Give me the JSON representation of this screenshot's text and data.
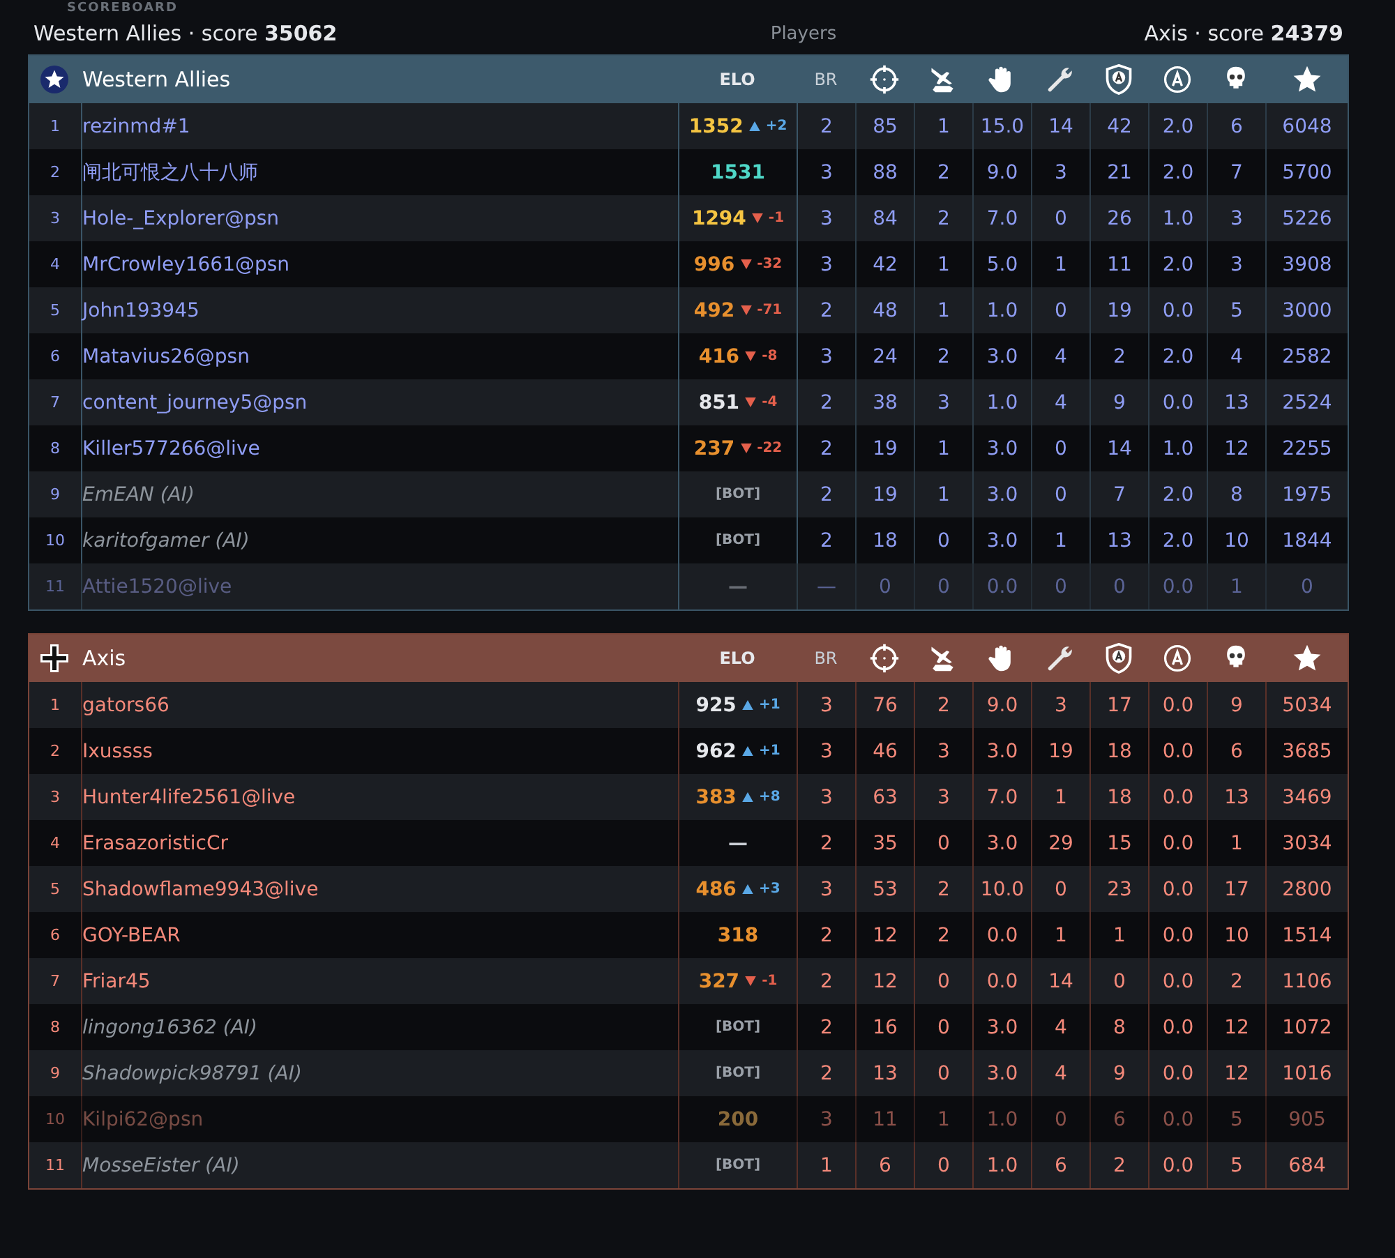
{
  "heading": "SCOREBOARD",
  "summary": {
    "left": "Western Allies · score **35062**",
    "center": "Players",
    "right": "Axis · score **24379**"
  },
  "teams": [
    {
      "name": "Western Allies",
      "kind": "allies",
      "columns": [
        "ELO",
        "BR"
      ],
      "rows": [
        {
          "rank": "1",
          "name": "rezinmd#1",
          "ai": false,
          "inactive": false,
          "elo": "1352",
          "color": "#f5c542",
          "kind": "gain",
          "delta": "+2",
          "stats": [
            "2",
            "85",
            "1",
            "15.0",
            "14",
            "42",
            "2.0",
            "6",
            "6048"
          ]
        },
        {
          "rank": "2",
          "name": "闸北可恨之八十八师",
          "ai": false,
          "inactive": false,
          "elo": "1531",
          "color": "#4fd8c8",
          "kind": "steady",
          "stats": [
            "3",
            "88",
            "2",
            "9.0",
            "3",
            "21",
            "2.0",
            "7",
            "5700"
          ]
        },
        {
          "rank": "3",
          "name": "Hole-_Explorer@psn",
          "ai": false,
          "inactive": false,
          "elo": "1294",
          "color": "#f5c542",
          "kind": "loss",
          "delta": "-1",
          "stats": [
            "3",
            "84",
            "2",
            "7.0",
            "0",
            "26",
            "1.0",
            "3",
            "5226"
          ]
        },
        {
          "rank": "4",
          "name": "MrCrowley1661@psn",
          "ai": false,
          "inactive": false,
          "elo": "996",
          "color": "#e8902e",
          "kind": "loss",
          "delta": "-32",
          "stats": [
            "3",
            "42",
            "1",
            "5.0",
            "1",
            "11",
            "2.0",
            "3",
            "3908"
          ]
        },
        {
          "rank": "5",
          "name": "John193945",
          "ai": false,
          "inactive": false,
          "elo": "492",
          "color": "#e8902e",
          "kind": "loss",
          "delta": "-71",
          "stats": [
            "2",
            "48",
            "1",
            "1.0",
            "0",
            "19",
            "0.0",
            "5",
            "3000"
          ]
        },
        {
          "rank": "6",
          "name": "Matavius26@psn",
          "ai": false,
          "inactive": false,
          "elo": "416",
          "color": "#e8902e",
          "kind": "loss",
          "delta": "-8",
          "stats": [
            "3",
            "24",
            "2",
            "3.0",
            "4",
            "2",
            "2.0",
            "4",
            "2582"
          ]
        },
        {
          "rank": "7",
          "name": "content_journey5@psn",
          "ai": false,
          "inactive": false,
          "elo": "851",
          "color": "#e6e8ec",
          "kind": "loss",
          "delta": "-4",
          "stats": [
            "2",
            "38",
            "3",
            "1.0",
            "4",
            "9",
            "0.0",
            "13",
            "2524"
          ]
        },
        {
          "rank": "8",
          "name": "Killer577266@live",
          "ai": false,
          "inactive": false,
          "elo": "237",
          "color": "#e8902e",
          "kind": "loss",
          "delta": "-22",
          "stats": [
            "2",
            "19",
            "1",
            "3.0",
            "0",
            "14",
            "1.0",
            "12",
            "2255"
          ]
        },
        {
          "rank": "9",
          "name": "EmEAN (AI)",
          "ai": true,
          "inactive": false,
          "elo": "[BOT]",
          "kind": "steady",
          "stats": [
            "2",
            "19",
            "1",
            "3.0",
            "0",
            "7",
            "2.0",
            "8",
            "1975"
          ]
        },
        {
          "rank": "10",
          "name": "karitofgamer (AI)",
          "ai": true,
          "inactive": false,
          "elo": "[BOT]",
          "kind": "steady",
          "stats": [
            "2",
            "18",
            "0",
            "3.0",
            "1",
            "13",
            "2.0",
            "10",
            "1844"
          ]
        },
        {
          "rank": "11",
          "name": "Attie1520@live",
          "ai": false,
          "inactive": true,
          "elo": "—",
          "kind": "steady",
          "stats": [
            "—",
            "0",
            "0",
            "0.0",
            "0",
            "0",
            "0.0",
            "1",
            "0"
          ]
        }
      ]
    },
    {
      "name": "Axis",
      "kind": "axis",
      "columns": [
        "ELO",
        "BR"
      ],
      "rows": [
        {
          "rank": "1",
          "name": "gators66",
          "ai": false,
          "inactive": false,
          "elo": "925",
          "color": "#e6e8ec",
          "kind": "gain",
          "delta": "+1",
          "stats": [
            "3",
            "76",
            "2",
            "9.0",
            "3",
            "17",
            "0.0",
            "9",
            "5034"
          ]
        },
        {
          "rank": "2",
          "name": "Ixussss",
          "ai": false,
          "inactive": false,
          "elo": "962",
          "color": "#e6e8ec",
          "kind": "gain",
          "delta": "+1",
          "stats": [
            "3",
            "46",
            "3",
            "3.0",
            "19",
            "18",
            "0.0",
            "6",
            "3685"
          ]
        },
        {
          "rank": "3",
          "name": "Hunter4life2561@live",
          "ai": false,
          "inactive": false,
          "elo": "383",
          "color": "#e8902e",
          "kind": "gain",
          "delta": "+8",
          "stats": [
            "3",
            "63",
            "3",
            "7.0",
            "1",
            "18",
            "0.0",
            "13",
            "3469"
          ]
        },
        {
          "rank": "4",
          "name": "ErasazoristicCr",
          "ai": false,
          "inactive": false,
          "elo": "—",
          "kind": "steady",
          "stats": [
            "2",
            "35",
            "0",
            "3.0",
            "29",
            "15",
            "0.0",
            "1",
            "3034"
          ]
        },
        {
          "rank": "5",
          "name": "Shadowflame9943@live",
          "ai": false,
          "inactive": false,
          "elo": "486",
          "color": "#e8902e",
          "kind": "gain",
          "delta": "+3",
          "stats": [
            "3",
            "53",
            "2",
            "10.0",
            "0",
            "23",
            "0.0",
            "17",
            "2800"
          ]
        },
        {
          "rank": "6",
          "name": "GOY-BEAR",
          "ai": false,
          "inactive": false,
          "elo": "318",
          "color": "#e8902e",
          "kind": "steady",
          "stats": [
            "2",
            "12",
            "2",
            "0.0",
            "1",
            "1",
            "0.0",
            "10",
            "1514"
          ]
        },
        {
          "rank": "7",
          "name": "Friar45",
          "ai": false,
          "inactive": false,
          "elo": "327",
          "color": "#e8902e",
          "kind": "loss",
          "delta": "-1",
          "stats": [
            "2",
            "12",
            "0",
            "0.0",
            "14",
            "0",
            "0.0",
            "2",
            "1106"
          ]
        },
        {
          "rank": "8",
          "name": "lingong16362 (AI)",
          "ai": true,
          "inactive": false,
          "elo": "[BOT]",
          "kind": "steady",
          "stats": [
            "2",
            "16",
            "0",
            "3.0",
            "4",
            "8",
            "0.0",
            "12",
            "1072"
          ]
        },
        {
          "rank": "9",
          "name": "Shadowpick98791 (AI)",
          "ai": true,
          "inactive": false,
          "elo": "[BOT]",
          "kind": "steady",
          "stats": [
            "2",
            "13",
            "0",
            "3.0",
            "4",
            "9",
            "0.0",
            "12",
            "1016"
          ]
        },
        {
          "rank": "10",
          "name": "Kilpi62@psn",
          "ai": false,
          "inactive": true,
          "elo": "200",
          "color": "#8a6a3a",
          "kind": "steady",
          "stats": [
            "3",
            "11",
            "1",
            "1.0",
            "0",
            "6",
            "0.0",
            "5",
            "905"
          ]
        },
        {
          "rank": "11",
          "name": "MosseEister (AI)",
          "ai": true,
          "inactive": false,
          "elo": "[BOT]",
          "kind": "steady",
          "stats": [
            "1",
            "6",
            "0",
            "1.0",
            "6",
            "2",
            "0.0",
            "5",
            "684"
          ]
        }
      ]
    }
  ]
}
